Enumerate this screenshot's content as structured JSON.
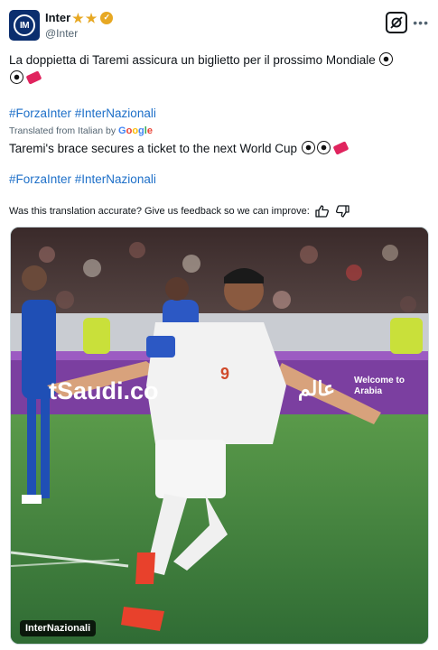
{
  "author": {
    "display_name": "Inter",
    "handle": "@Inter",
    "avatar_text": "IM"
  },
  "tweet": {
    "text_line1": "La doppietta di Taremi assicura un biglietto per il prossimo Mondiale",
    "hashtags": "#ForzaInter #InterNazionali",
    "translated_label": "Translated from Italian by",
    "translated_text": "Taremi's brace secures a ticket to the next World Cup",
    "hashtags_translated": "#ForzaInter #InterNazionali",
    "feedback_prompt": "Was this translation accurate? Give us feedback so we can improve:"
  },
  "google_logo": [
    "G",
    "o",
    "o",
    "g",
    "l",
    "e"
  ],
  "media": {
    "caption": "InterNazionali",
    "ad_text_left": "tSaudi.co",
    "ad_text_right": "Welcome to Arabia",
    "ad_arabic": "عالم",
    "shirt_number": "9"
  },
  "icons": {
    "more": "more-icon",
    "grok": "grok-icon",
    "thumbs_up": "thumbs-up-icon",
    "thumbs_down": "thumbs-down-icon",
    "verified": "verified-badge-icon"
  },
  "colors": {
    "link": "#1d6fc8",
    "avatar_bg": "#0b2e6e",
    "badge_gold": "#e7a823",
    "ad_purple": "#7b3fa0",
    "pitch_green": "#2f6b34"
  }
}
